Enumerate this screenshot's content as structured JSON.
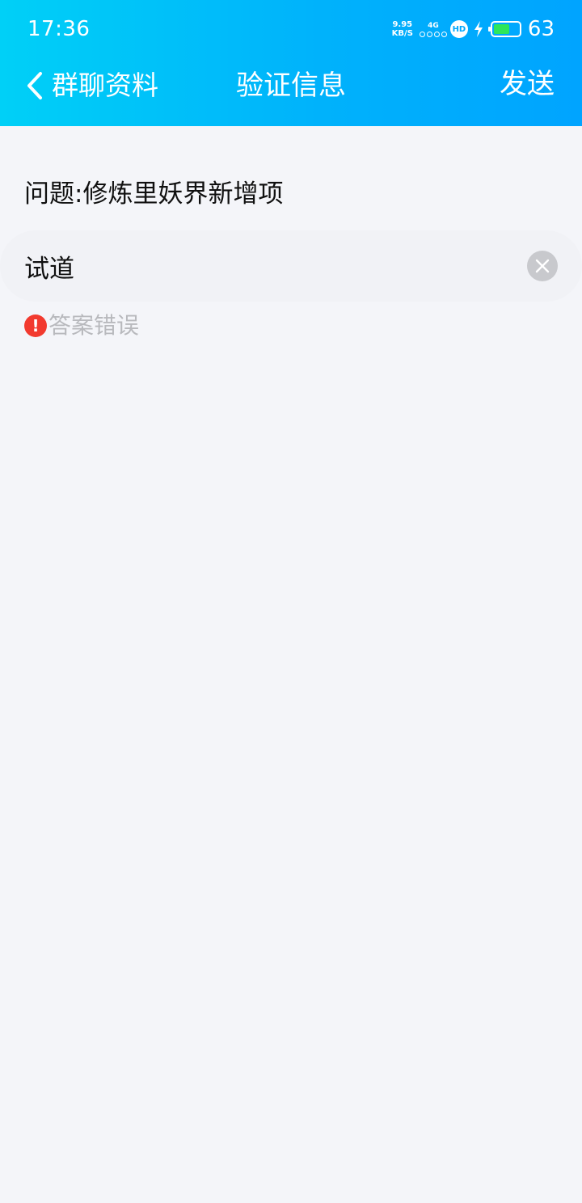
{
  "status_bar": {
    "time": "17:36",
    "net_speed_value": "9.95",
    "net_speed_unit": "KB/S",
    "signal_label": "4G",
    "hd_badge": "HD",
    "battery_level": "63",
    "battery_fraction": 0.63,
    "battery_fill_color": "#2ee65a"
  },
  "nav": {
    "back_label": "群聊资料",
    "title": "验证信息",
    "send_label": "发送"
  },
  "form": {
    "question": "问题:修炼里妖界新增项",
    "answer_value": "试道",
    "error_message": "答案错误"
  },
  "colors": {
    "header_gradient_start": "#00d0f7",
    "header_gradient_end": "#00a4ff",
    "error_red": "#f23a2f",
    "error_text": "#b8b9bd",
    "background": "#f4f5f9"
  },
  "icons": {
    "back": "chevron-left-icon",
    "clear": "close-circle-icon",
    "error": "exclamation-circle-icon",
    "charging": "bolt-icon",
    "battery": "battery-icon",
    "hd": "hd-badge-icon"
  }
}
